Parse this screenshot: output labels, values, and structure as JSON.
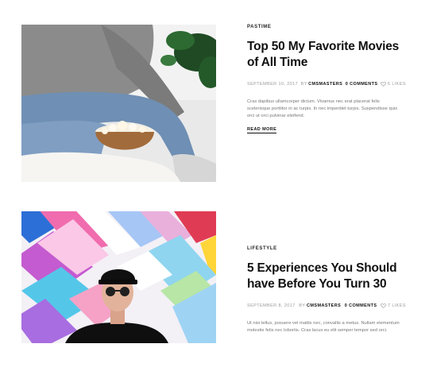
{
  "posts": [
    {
      "category": "Pastime",
      "title": "Top 50 My Favorite Movies of All Time",
      "date": "September 10, 2017",
      "by": "by",
      "author": "cmsmasters",
      "comments": "0 Comments",
      "likes": "6 Likes",
      "excerpt": "Cras dapibus ullamcorper dictum. Vivamus nec erat placerat felis scelerisque porttitor in ac turpis. In nec imperdiet turpis. Suspendisse quis orci ut orci pulvinar eleifend.",
      "read_more": "Read More"
    },
    {
      "category": "Lifestyle",
      "title": "5 Experiences You Should have Before You Turn 30",
      "date": "September 8, 2017",
      "by": "by",
      "author": "cmsmasters",
      "comments": "0 Comments",
      "likes": "7 Likes",
      "excerpt": "Ut nisi tellus, posuere vel mattis nec, convallis a metus. Nullam elementum molestie felis nec lobortis. Cras lacus eu elit semper tempor sed orci."
    }
  ],
  "icons": {
    "heart": "heart-icon"
  },
  "colors": {
    "text_dark": "#111111",
    "text_meta": "#9a9a9a",
    "text_excerpt": "#777777"
  }
}
